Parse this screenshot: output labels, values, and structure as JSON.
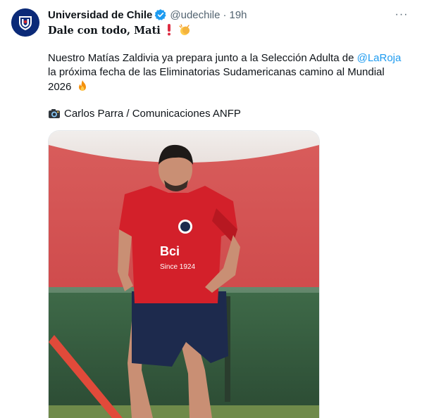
{
  "tweet": {
    "author_name": "Universidad de Chile",
    "handle": "@udechile",
    "separator": "·",
    "time": "19h",
    "more_label": "···",
    "headline": "Dale con todo, Mati",
    "body_line1_prefix": "Nuestro Matías Zaldivia ya prepara junto a la Selección Adulta de ",
    "mention": "@LaRoja",
    "body_line2": "la próxima fecha de las Eliminatorias  Sudamericanas camino al Mundial",
    "body_line3": "2026",
    "credit": "Carlos Parra / Comunicaciones ANFP",
    "photo": {
      "jersey_sponsor": "Bci",
      "jersey_text": "Since 1924"
    }
  },
  "colors": {
    "link": "#1d9bf0",
    "verified": "#1d9bf0",
    "muted": "#536471",
    "jersey_red": "#d3202a",
    "shorts_navy": "#1d2a4d",
    "avatar_blue": "#0b2a78"
  },
  "icons": {
    "verified": "verified-badge-icon",
    "more": "more-options-icon",
    "exclamation": "red-exclamation-emoji",
    "clap": "clapping-hands-emoji",
    "fire": "fire-emoji",
    "camera": "camera-emoji"
  }
}
